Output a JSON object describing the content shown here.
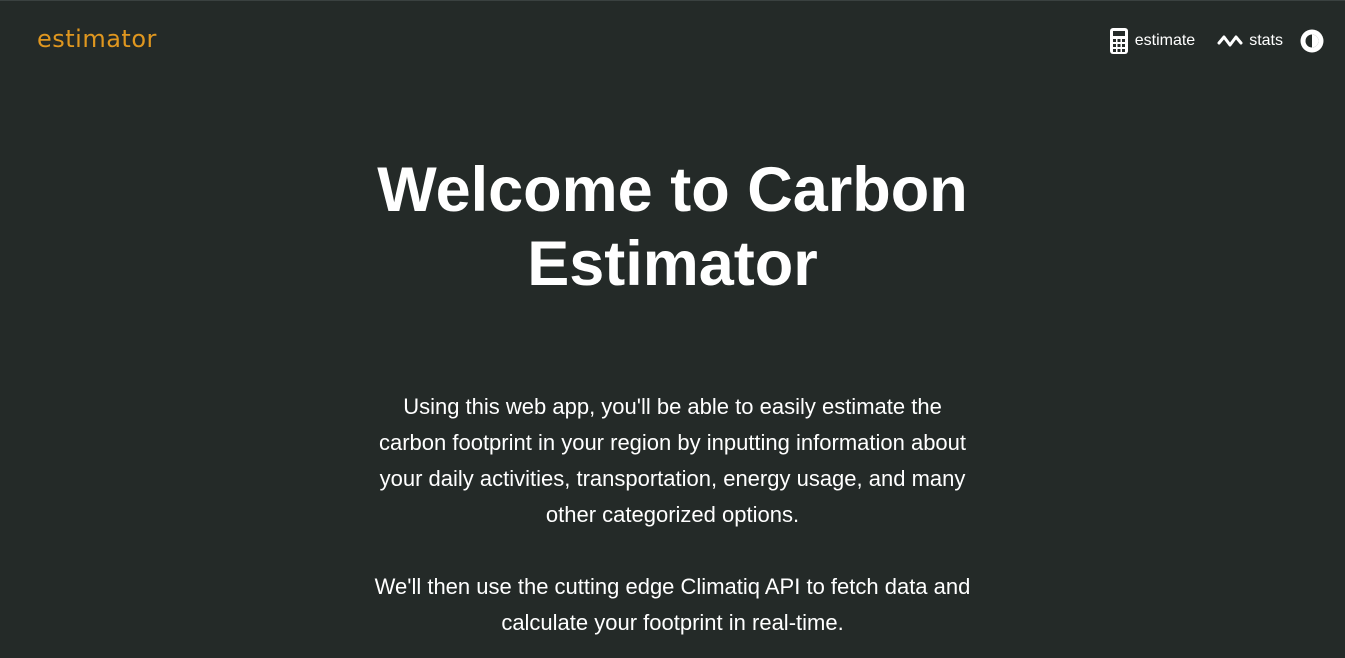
{
  "header": {
    "logo": "estimator",
    "nav": {
      "estimate_label": "estimate",
      "stats_label": "stats"
    },
    "icons": {
      "estimate": "calculator-icon",
      "stats": "activity-wave-icon",
      "theme": "theme-toggle-icon"
    }
  },
  "hero": {
    "title_line1": "Welcome to Carbon",
    "title_line2": "Estimator"
  },
  "intro": {
    "paragraph1_lines": [
      "Using this web app, you'll be able to easily estimate the",
      "carbon footprint in your region by inputting information about",
      "your daily activities, transportation, energy usage, and many",
      "other categorized options."
    ],
    "paragraph2_lines": [
      "We'll then use the cutting edge Climatiq API to fetch data and",
      "calculate your footprint in real-time."
    ]
  },
  "colors": {
    "background": "#242a28",
    "brand": "#e0971f",
    "text": "#ffffff"
  }
}
